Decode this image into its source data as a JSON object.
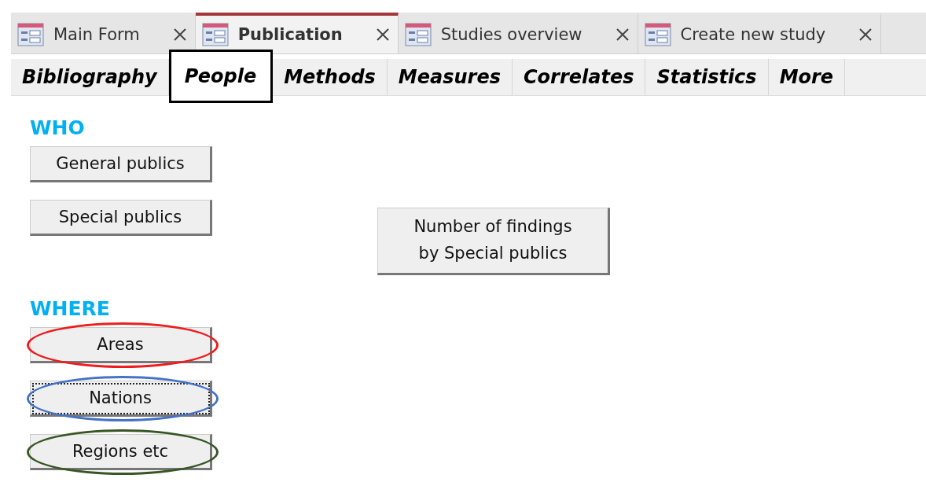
{
  "document_tabs": [
    {
      "label": "Main Form",
      "selected": false
    },
    {
      "label": "Publication",
      "selected": true
    },
    {
      "label": "Studies overview",
      "selected": false
    },
    {
      "label": "Create new study",
      "selected": false
    }
  ],
  "form_tabs": [
    {
      "label": "Bibliography",
      "selected": false
    },
    {
      "label": "People",
      "selected": true
    },
    {
      "label": "Methods",
      "selected": false
    },
    {
      "label": "Measures",
      "selected": false
    },
    {
      "label": "Correlates",
      "selected": false
    },
    {
      "label": "Statistics",
      "selected": false
    },
    {
      "label": "More",
      "selected": false
    }
  ],
  "sections": [
    {
      "heading": "WHO",
      "buttons": [
        {
          "label": "General publics",
          "focused": false
        },
        {
          "label": "Special publics",
          "focused": false
        }
      ]
    },
    {
      "heading": "WHERE",
      "buttons": [
        {
          "label": "Areas",
          "focused": false,
          "color": "#ee1c1c"
        },
        {
          "label": "Nations",
          "focused": true,
          "color": "#4472c4"
        },
        {
          "label": "Regions etc",
          "focused": false,
          "color": "#375623"
        }
      ]
    }
  ],
  "findings_button": {
    "label": "Number of findings by Special publics"
  }
}
